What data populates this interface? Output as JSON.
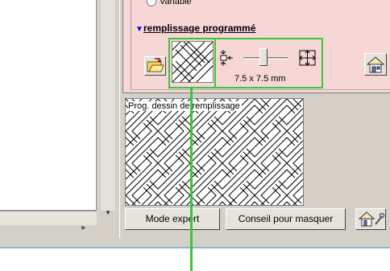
{
  "pattern_panel": {
    "variable_label": "Variable",
    "section_title": "remplissage programmé",
    "section_caret": "▼",
    "size_label": "7.5 x 7.5 mm",
    "preview_label": "Prog. dessin de remplissage",
    "slider_value": 0.45
  },
  "footer_buttons": {
    "expert_label": "Mode expert",
    "conseil_label": "Conseil pour masquer"
  },
  "icons": {
    "folder": "folder-open-icon",
    "pattern": "fill-pattern-icon",
    "zoom": "zoom-out-icon",
    "size": "resize-icon",
    "house": "house-icon",
    "house_settings": "house-settings-icon"
  },
  "colors": {
    "highlight_green": "#37c837",
    "panel_pink": "#f7d6d6",
    "section_caret_blue": "#0000cc"
  }
}
